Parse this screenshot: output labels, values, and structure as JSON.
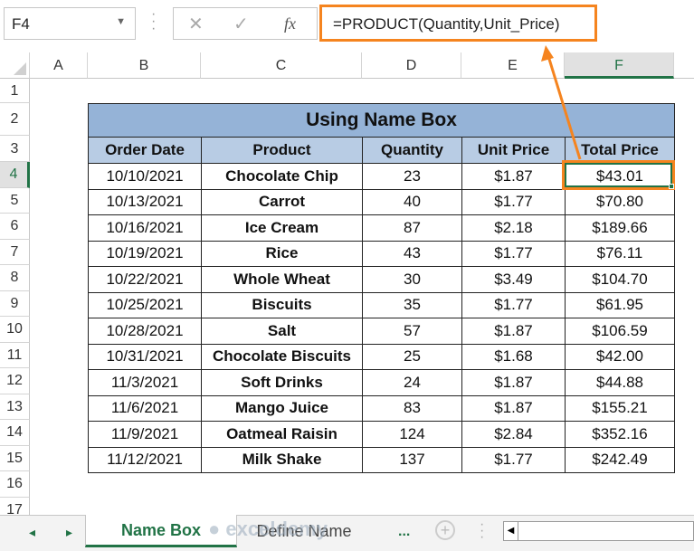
{
  "name_box": {
    "value": "F4"
  },
  "formula_bar": {
    "cancel_icon": "✕",
    "enter_icon": "✓",
    "fx_label": "fx",
    "formula": "=PRODUCT(Quantity,Unit_Price)"
  },
  "columns": [
    "A",
    "B",
    "C",
    "D",
    "E",
    "F"
  ],
  "rows": [
    "1",
    "2",
    "3",
    "4",
    "5",
    "6",
    "7",
    "8",
    "9",
    "10",
    "11",
    "12",
    "13",
    "14",
    "15",
    "16",
    "17"
  ],
  "selected_cell": "F4",
  "table": {
    "title": "Using Name Box",
    "headers": [
      "Order Date",
      "Product",
      "Quantity",
      "Unit Price",
      "Total Price"
    ],
    "rows": [
      [
        "10/10/2021",
        "Chocolate Chip",
        "23",
        "$1.87",
        "$43.01"
      ],
      [
        "10/13/2021",
        "Carrot",
        "40",
        "$1.77",
        "$70.80"
      ],
      [
        "10/16/2021",
        "Ice Cream",
        "87",
        "$2.18",
        "$189.66"
      ],
      [
        "10/19/2021",
        "Rice",
        "43",
        "$1.77",
        "$76.11"
      ],
      [
        "10/22/2021",
        "Whole Wheat",
        "30",
        "$3.49",
        "$104.70"
      ],
      [
        "10/25/2021",
        "Biscuits",
        "35",
        "$1.77",
        "$61.95"
      ],
      [
        "10/28/2021",
        "Salt",
        "57",
        "$1.87",
        "$106.59"
      ],
      [
        "10/31/2021",
        "Chocolate Biscuits",
        "25",
        "$1.68",
        "$42.00"
      ],
      [
        "11/3/2021",
        "Soft Drinks",
        "24",
        "$1.87",
        "$44.88"
      ],
      [
        "11/6/2021",
        "Mango Juice",
        "83",
        "$1.87",
        "$155.21"
      ],
      [
        "11/9/2021",
        "Oatmeal Raisin",
        "124",
        "$2.84",
        "$352.16"
      ],
      [
        "11/12/2021",
        "Milk Shake",
        "137",
        "$1.77",
        "$242.49"
      ]
    ]
  },
  "sheet_tabs": {
    "prev": "◂",
    "next": "▸",
    "more": "...",
    "tabs": [
      "Name Box",
      "Define Name"
    ],
    "active": "Name Box",
    "more_right": "...",
    "add": "+"
  },
  "watermark": "exceldemy",
  "colors": {
    "accent": "#f5841f",
    "excel_green": "#217346",
    "title_fill": "#95b3d7",
    "header_fill": "#b8cce4"
  }
}
